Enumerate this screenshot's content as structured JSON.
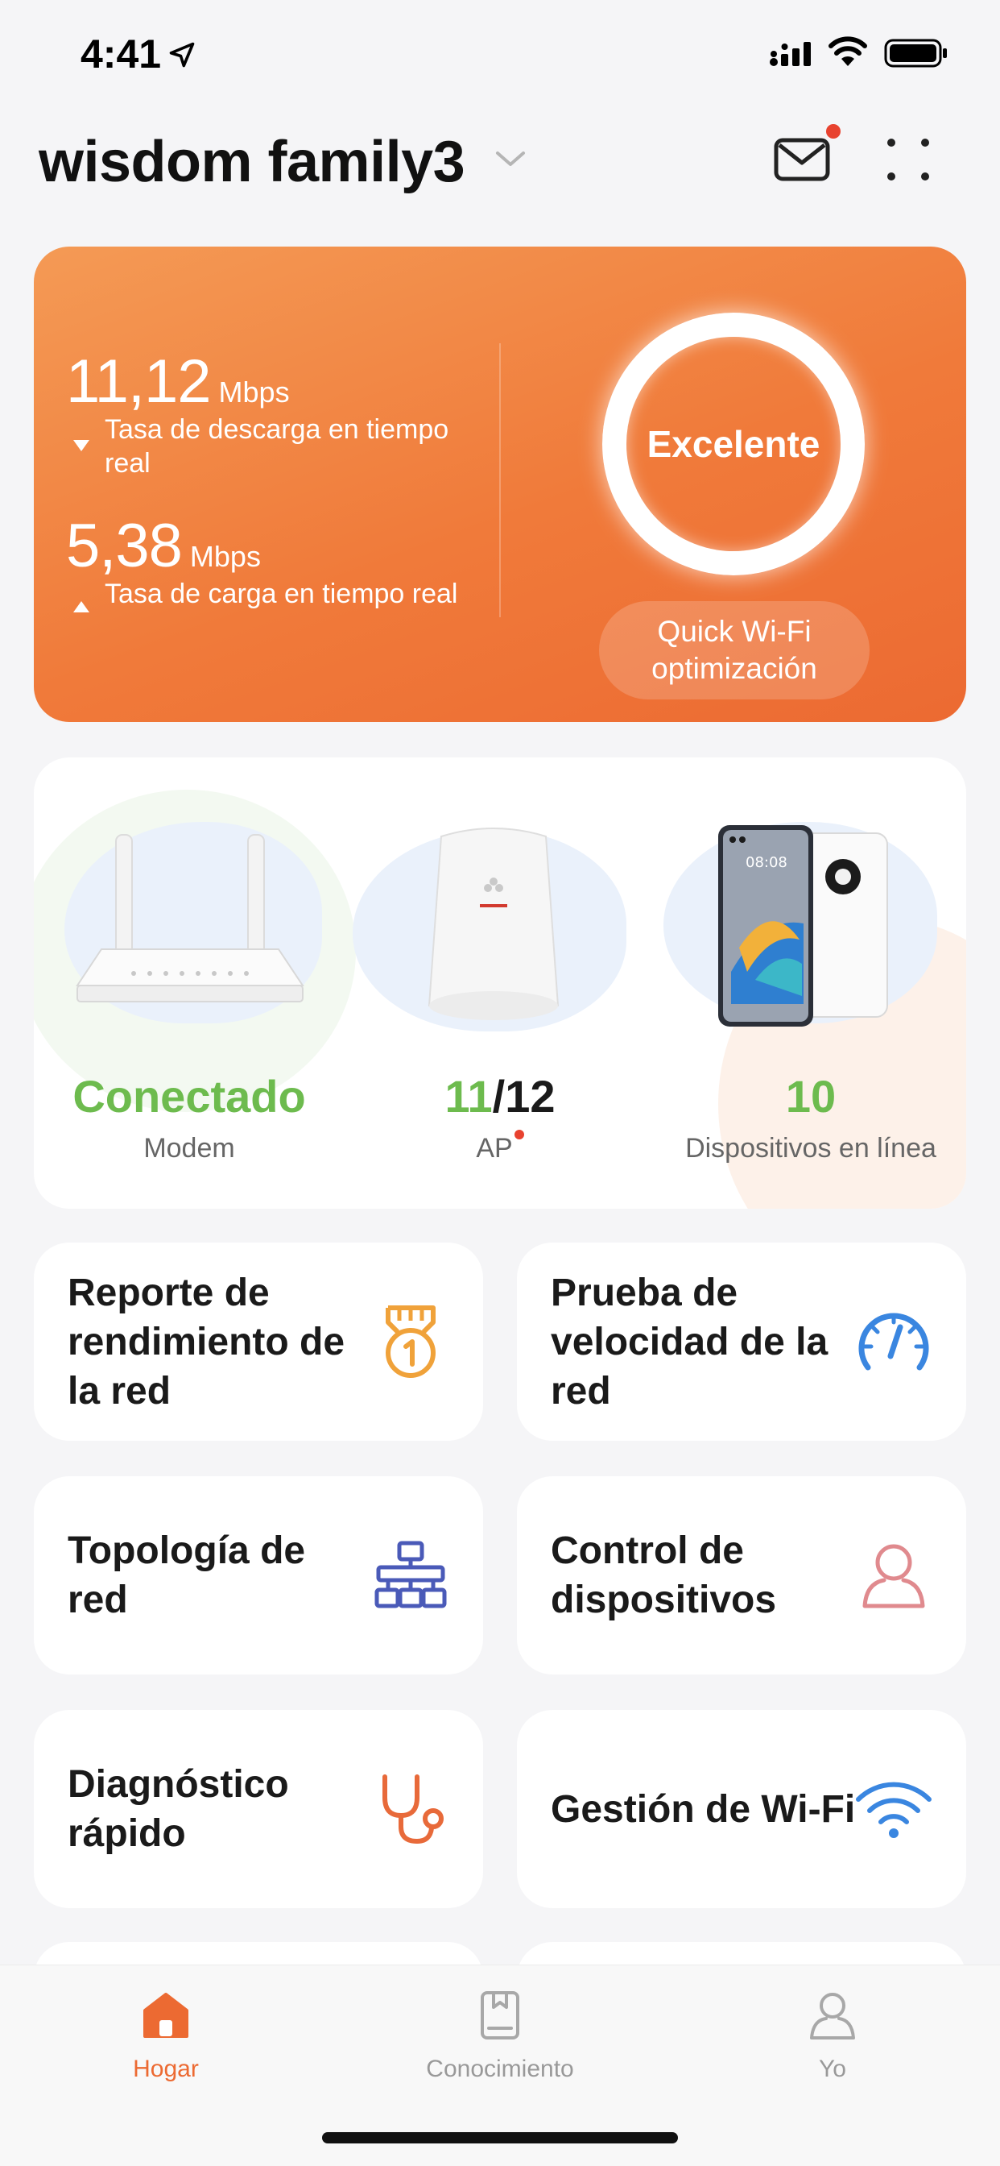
{
  "status_bar": {
    "time": "4:41"
  },
  "header": {
    "title": "wisdom family3"
  },
  "hero": {
    "download_value": "11,12",
    "download_unit": "Mbps",
    "download_label": "Tasa de descarga en tiempo real",
    "upload_value": "5,38",
    "upload_unit": "Mbps",
    "upload_label": "Tasa de carga en tiempo real",
    "quality": "Excelente",
    "optimize_label": "Quick Wi-Fi optimización"
  },
  "devices": {
    "modem_status": "Conectado",
    "modem_label": "Modem",
    "ap_online": "11",
    "ap_total": "/12",
    "ap_label": "AP",
    "online_count": "10",
    "online_label": "Dispositivos en línea",
    "phone_time": "08:08"
  },
  "tiles": [
    {
      "label": "Reporte de rendimiento de la red",
      "icon": "medal-icon"
    },
    {
      "label": "Prueba de velocidad de la red",
      "icon": "speedometer-icon"
    },
    {
      "label": "Topología de red",
      "icon": "topology-icon"
    },
    {
      "label": "Control de dispositivos",
      "icon": "user-icon"
    },
    {
      "label": "Diagnóstico rápido",
      "icon": "stethoscope-icon"
    },
    {
      "label": "Gestión de Wi-Fi",
      "icon": "wifi-icon"
    }
  ],
  "tabbar": {
    "items": [
      {
        "label": "Hogar",
        "icon": "home-icon",
        "active": true
      },
      {
        "label": "Conocimiento",
        "icon": "book-icon",
        "active": false
      },
      {
        "label": "Yo",
        "icon": "profile-icon",
        "active": false
      }
    ]
  },
  "colors": {
    "accent": "#ec6a32",
    "success": "#6dbb4e",
    "notification": "#e8422f"
  }
}
